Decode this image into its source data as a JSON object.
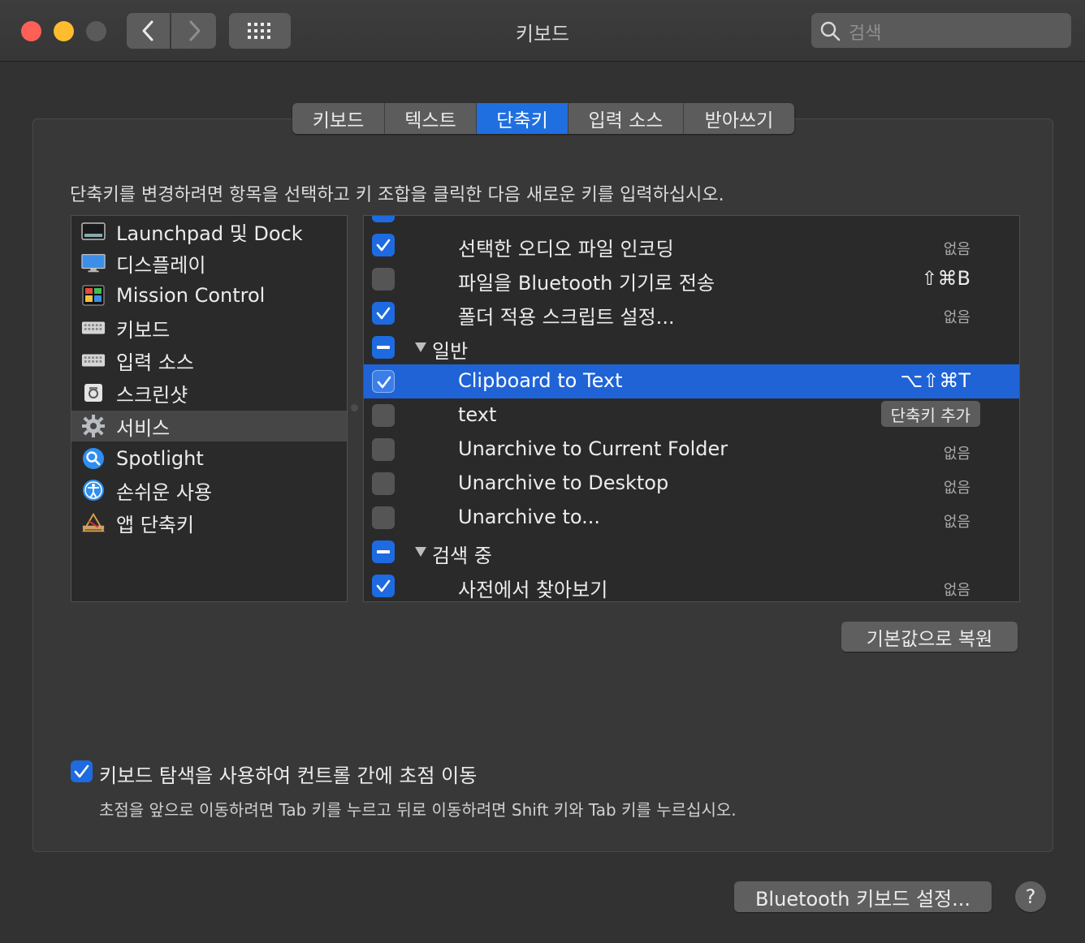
{
  "window": {
    "title": "키보드"
  },
  "search": {
    "placeholder": "검색"
  },
  "tabs": [
    {
      "label": "키보드",
      "active": false
    },
    {
      "label": "텍스트",
      "active": false
    },
    {
      "label": "단축키",
      "active": true
    },
    {
      "label": "입력 소스",
      "active": false
    },
    {
      "label": "받아쓰기",
      "active": false
    }
  ],
  "instructions": "단축키를 변경하려면 항목을 선택하고 키 조합을 클릭한 다음 새로운 키를 입력하십시오.",
  "categories": [
    {
      "label": "Launchpad 및 Dock",
      "icon": "launchpad-dock-icon"
    },
    {
      "label": "디스플레이",
      "icon": "display-icon"
    },
    {
      "label": "Mission Control",
      "icon": "mission-control-icon"
    },
    {
      "label": "키보드",
      "icon": "keyboard-icon"
    },
    {
      "label": "입력 소스",
      "icon": "input-source-icon"
    },
    {
      "label": "스크린샷",
      "icon": "screenshot-icon"
    },
    {
      "label": "서비스",
      "icon": "gear-icon",
      "selected": true
    },
    {
      "label": "Spotlight",
      "icon": "spotlight-icon"
    },
    {
      "label": "손쉬운 사용",
      "icon": "accessibility-icon"
    },
    {
      "label": "앱 단축키",
      "icon": "app-shortcuts-icon"
    }
  ],
  "services": [
    {
      "label": "선택한 오디오 파일 인코딩",
      "state": "checked",
      "shortcut": "없음"
    },
    {
      "label": "파일을 Bluetooth 기기로 전송",
      "state": "unchecked",
      "shortcut": "⇧⌘B"
    },
    {
      "label": "폴더 적용 스크립트 설정...",
      "state": "checked",
      "shortcut": "없음"
    },
    {
      "label": "일반",
      "state": "mixed",
      "group": true
    },
    {
      "label": "Clipboard to Text",
      "state": "checked",
      "shortcut": "⌥⇧⌘T",
      "selected": true
    },
    {
      "label": "text",
      "state": "unchecked",
      "action": "단축키 추가"
    },
    {
      "label": "Unarchive to Current Folder",
      "state": "unchecked",
      "shortcut": "없음"
    },
    {
      "label": "Unarchive to Desktop",
      "state": "unchecked",
      "shortcut": "없음"
    },
    {
      "label": "Unarchive to...",
      "state": "unchecked",
      "shortcut": "없음"
    },
    {
      "label": "검색 중",
      "state": "mixed",
      "group": true
    },
    {
      "label": "사전에서 찾아보기",
      "state": "checked",
      "shortcut": "없음"
    }
  ],
  "restore_button": "기본값으로 복원",
  "keyboard_nav": {
    "label": "키보드 탐색을 사용하여 컨트롤 간에 초점 이동",
    "checked": true,
    "hint": "초점을 앞으로 이동하려면 Tab 키를 누르고 뒤로 이동하려면 Shift 키와 Tab 키를 누르십시오."
  },
  "bluetooth_button": "Bluetooth 키보드 설정...",
  "help_button": "?",
  "colors": {
    "accent": "#1f6fe0",
    "selection": "#1f63d6",
    "background": "#323232"
  }
}
